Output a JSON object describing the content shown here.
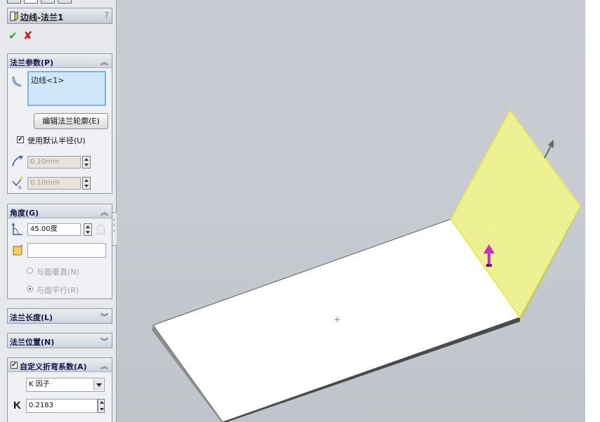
{
  "feature": {
    "title": "边线-法兰1",
    "help": "?",
    "ok_label": "✔",
    "cancel_label": "✘"
  },
  "flange_params": {
    "header": "法兰参数(P)",
    "selection": "边线<1>",
    "edit_profile_button": "编辑法兰轮廓(E)",
    "use_default_radius": {
      "label": "使用默认半径(U)",
      "checked": true
    },
    "bend_radius": "0.10mm",
    "gap_distance": "0.10mm"
  },
  "angle": {
    "header": "角度(G)",
    "value": "45.00度",
    "reference_face": "",
    "option_perpendicular": "与面垂直(N)",
    "option_parallel": "与面平行(R)",
    "selected_option": "option_parallel"
  },
  "flange_length": {
    "header": "法兰长度(L)"
  },
  "flange_position": {
    "header": "法兰位置(N)"
  },
  "bend_allowance": {
    "header": "自定义折弯系数(A)",
    "checked": true,
    "type": "K 因子",
    "k_label": "K",
    "k_value": "0.2183"
  },
  "colors": {
    "panel_bg": "#e6e8ec",
    "group_header": "#cfd4dc",
    "viewport_bg": "#c7cbd2",
    "flange_preview": "#f1f39a",
    "direction_arrow": "#cc2ec4",
    "ok": "#2aa52a",
    "cancel": "#d21a1a"
  },
  "icons": [
    "feature-icon",
    "edge-select-icon",
    "bend-radius-icon",
    "gap-distance-icon",
    "angle-icon",
    "face-icon",
    "k-factor-icon",
    "direction-arrow-icon",
    "collapse-icon",
    "expand-icon"
  ]
}
